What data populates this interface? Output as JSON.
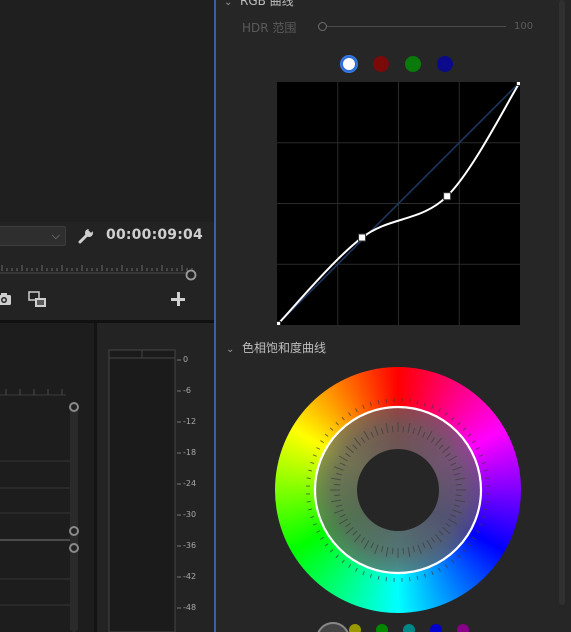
{
  "source_monitor": {
    "timecode": "00:00:09:04"
  },
  "audio_meter": {
    "db_scale": [
      "0",
      "-6",
      "-12",
      "-18",
      "-24",
      "-30",
      "-36",
      "-42",
      "-48"
    ]
  },
  "lumetri": {
    "rgb_curves": {
      "section_title": "RGB 曲线",
      "hdr_label": "HDR 范围",
      "hdr_value": "100",
      "channels": [
        {
          "name": "white",
          "color": "#ffffff",
          "selected": true
        },
        {
          "name": "red",
          "color": "#7a0a0a",
          "selected": false
        },
        {
          "name": "green",
          "color": "#0a7a0a",
          "selected": false
        },
        {
          "name": "blue",
          "color": "#0a0a8a",
          "selected": false
        }
      ],
      "curve_points": [
        {
          "input": 0.0,
          "output": 0.0
        },
        {
          "input": 0.35,
          "output": 0.36
        },
        {
          "input": 0.7,
          "output": 0.53
        },
        {
          "input": 1.0,
          "output": 1.0
        }
      ]
    },
    "hue_sat_curves": {
      "section_title": "色相饱和度曲线",
      "bottom_swatches": [
        "#444444",
        "#9a9a00",
        "#008800",
        "#008888",
        "#0000cc",
        "#880088"
      ]
    }
  }
}
